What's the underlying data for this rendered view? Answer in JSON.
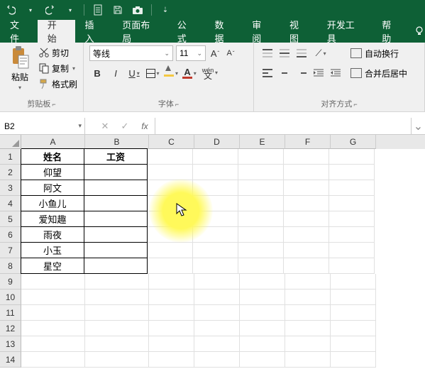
{
  "titlebar": {
    "undo_icon": "↶",
    "redo_icon": "↷",
    "doc_icon": "▤",
    "save_icon": "💾",
    "camera_icon": "📷",
    "more_icon": "⇣"
  },
  "menu": {
    "items": [
      "文件",
      "开始",
      "插入",
      "页面布局",
      "公式",
      "数据",
      "审阅",
      "视图",
      "开发工具",
      "帮助"
    ],
    "active_index": 1
  },
  "ribbon": {
    "clipboard": {
      "paste": "粘贴",
      "cut": "剪切",
      "copy": "复制",
      "format_painter": "格式刷",
      "group_label": "剪贴板"
    },
    "font": {
      "family": "等线",
      "size": "11",
      "bold": "B",
      "italic": "I",
      "underline": "U",
      "wen": "wén",
      "font_color_letter": "A",
      "group_label": "字体"
    },
    "align": {
      "wrap_text": "自动换行",
      "merge_center": "合并后居中",
      "group_label": "对齐方式"
    }
  },
  "fbar": {
    "namebox": "B2",
    "cancel": "✕",
    "confirm": "✓",
    "fx": "fx"
  },
  "columns": [
    "A",
    "B",
    "C",
    "D",
    "E",
    "F",
    "G"
  ],
  "row_numbers": [
    "1",
    "2",
    "3",
    "4",
    "5",
    "6",
    "7",
    "8",
    "9",
    "10",
    "11",
    "12",
    "13",
    "14"
  ],
  "cells": {
    "A1": "姓名",
    "B1": "工资",
    "A2": "仰望",
    "A3": "阿文",
    "A4": "小鱼儿",
    "A5": "爱知趣",
    "A6": "雨夜",
    "A7": "小玉",
    "A8": "星空"
  },
  "chart_data": {
    "type": "table",
    "headers": [
      "姓名",
      "工资"
    ],
    "rows": [
      [
        "仰望",
        ""
      ],
      [
        "阿文",
        ""
      ],
      [
        "小鱼儿",
        ""
      ],
      [
        "爱知趣",
        ""
      ],
      [
        "雨夜",
        ""
      ],
      [
        "小玉",
        ""
      ],
      [
        "星空",
        ""
      ]
    ]
  }
}
